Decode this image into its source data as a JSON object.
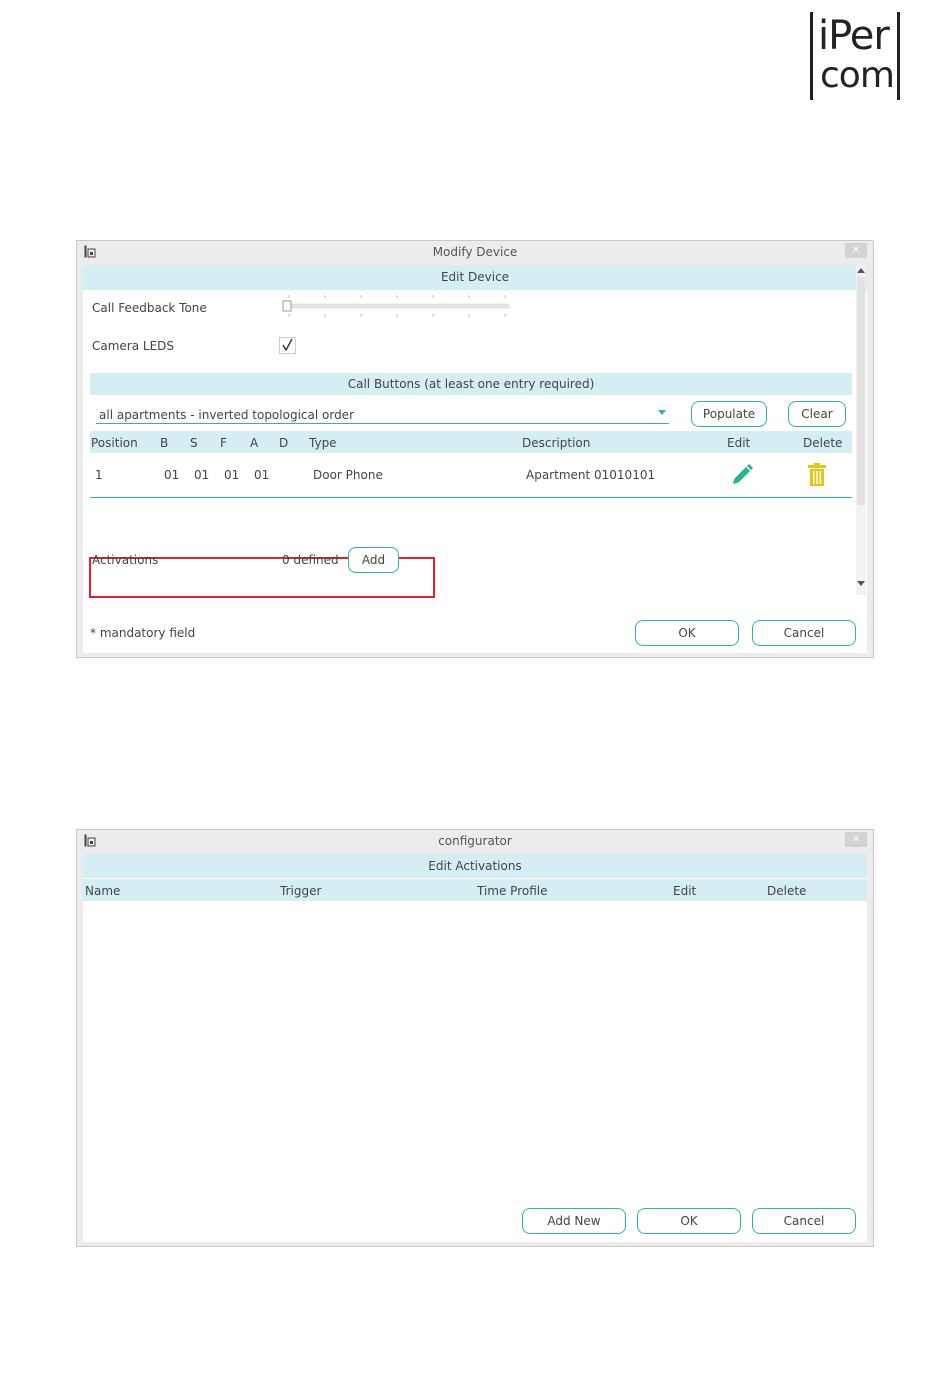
{
  "logo": {
    "line1": "iPer",
    "line2": "com"
  },
  "modify_device": {
    "window_title": "Modify Device",
    "section_title": "Edit Device",
    "call_feedback_tone_label": "Call Feedback Tone",
    "call_feedback_tone_value": 0,
    "camera_leds_label": "Camera LEDS",
    "camera_leds_checked": true,
    "call_buttons_title": "Call Buttons (at least one entry required)",
    "order_select": "all apartments - inverted topological order",
    "populate_button": "Populate",
    "clear_button": "Clear",
    "table_headers": {
      "position": "Position",
      "b": "B",
      "s": "S",
      "f": "F",
      "a": "A",
      "d": "D",
      "type": "Type",
      "description": "Description",
      "edit": "Edit",
      "delete": "Delete"
    },
    "rows": [
      {
        "position": "1",
        "b": "01",
        "s": "01",
        "f": "01",
        "a": "01",
        "d": "",
        "type": "Door Phone",
        "description": "Apartment 01010101"
      }
    ],
    "activations_label": "Activations",
    "activations_count": "0 defined",
    "add_button": "Add",
    "mandatory_note": "* mandatory field",
    "ok_button": "OK",
    "cancel_button": "Cancel"
  },
  "configurator": {
    "window_title": "configurator",
    "section_title": "Edit Activations",
    "table_headers": {
      "name": "Name",
      "trigger": "Trigger",
      "time_profile": "Time Profile",
      "edit": "Edit",
      "delete": "Delete"
    },
    "add_new_button": "Add New",
    "ok_button": "OK",
    "cancel_button": "Cancel"
  },
  "colors": {
    "accent": "#2cb5b0",
    "band": "#d5eef4",
    "edit_icon": "#22b58f",
    "delete_icon": "#e8c416",
    "highlight": "#e0232a"
  },
  "icons": {
    "edit": "pencil-icon",
    "delete": "trash-icon",
    "dropdown": "chevron-down-icon",
    "close": "close-icon"
  }
}
